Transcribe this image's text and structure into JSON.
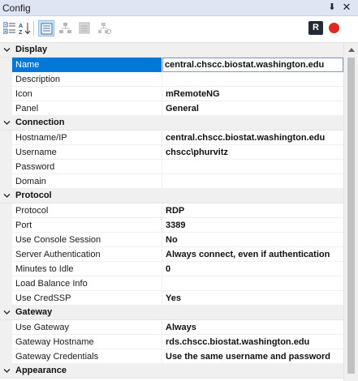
{
  "window": {
    "title": "Config",
    "pin_glyph": "⬇",
    "close_glyph": "✕"
  },
  "toolbar": {
    "buttons": [
      {
        "name": "categorized-view-button",
        "icon": "categorized-icon",
        "active": false
      },
      {
        "name": "alphabetical-sort-button",
        "icon": "sort-az-icon",
        "active": false
      },
      {
        "name": "properties-view-button",
        "icon": "properties-icon",
        "active": true
      },
      {
        "name": "inheritance-view-button",
        "icon": "inheritance-icon",
        "active": false
      },
      {
        "name": "default-properties-button",
        "icon": "default-properties-icon",
        "active": false
      },
      {
        "name": "default-inheritance-button",
        "icon": "default-inheritance-icon",
        "active": false
      }
    ],
    "rdp_label": "R"
  },
  "categories": [
    {
      "name": "Display",
      "properties": [
        {
          "name": "Name",
          "value": "central.chscc.biostat.washington.edu",
          "selected": true
        },
        {
          "name": "Description",
          "value": ""
        },
        {
          "name": "Icon",
          "value": "mRemoteNG"
        },
        {
          "name": "Panel",
          "value": "General"
        }
      ]
    },
    {
      "name": "Connection",
      "properties": [
        {
          "name": "Hostname/IP",
          "value": "central.chscc.biostat.washington.edu"
        },
        {
          "name": "Username",
          "value": "chscc\\phurvitz"
        },
        {
          "name": "Password",
          "value": ""
        },
        {
          "name": "Domain",
          "value": ""
        }
      ]
    },
    {
      "name": "Protocol",
      "properties": [
        {
          "name": "Protocol",
          "value": "RDP"
        },
        {
          "name": "Port",
          "value": "3389"
        },
        {
          "name": "Use Console Session",
          "value": "No"
        },
        {
          "name": "Server Authentication",
          "value": "Always connect, even if authentication"
        },
        {
          "name": "Minutes to Idle",
          "value": "0"
        },
        {
          "name": "Load Balance Info",
          "value": ""
        },
        {
          "name": "Use CredSSP",
          "value": "Yes"
        }
      ]
    },
    {
      "name": "Gateway",
      "properties": [
        {
          "name": "Use Gateway",
          "value": "Always"
        },
        {
          "name": "Gateway Hostname",
          "value": "rds.chscc.biostat.washington.edu"
        },
        {
          "name": "Gateway Credentials",
          "value": "Use the same username and password"
        }
      ]
    },
    {
      "name": "Appearance",
      "properties": []
    }
  ]
}
